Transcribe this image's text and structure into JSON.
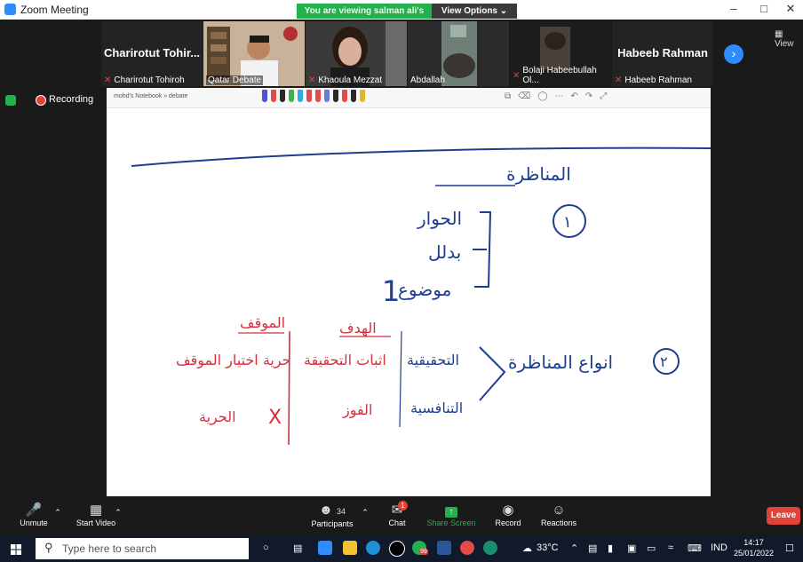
{
  "window": {
    "title": "Zoom Meeting"
  },
  "share_banner": {
    "text": "You are viewing salman ali's screen",
    "view_options": "View Options ⌄"
  },
  "window_controls": {
    "minimize": "–",
    "maximize": "□",
    "close": "✕"
  },
  "participants_strip": {
    "tiles": [
      {
        "big_name": "Charirotut Tohir...",
        "label": "Charirotut Tohiroh",
        "muted": true
      },
      {
        "label": "Qatar Debate",
        "muted": false
      },
      {
        "label": "Khaoula Mezzat",
        "muted": true
      },
      {
        "label": "Abdallah",
        "muted": false
      },
      {
        "label": "Bolaji Habeebullah Ol...",
        "muted": true
      },
      {
        "big_name": "Habeeb Rahman",
        "label": "Habeeb Rahman",
        "muted": true
      }
    ],
    "next_icon": "chevron-right-icon",
    "view_label": "View"
  },
  "recording": {
    "label": "Recording"
  },
  "notebook": {
    "breadcrumb": "mohd's Notebook » debate",
    "pen_colors": [
      "#4a53d6",
      "#e34a4a",
      "#2a2a2a",
      "#39b54a",
      "#2ab0e0",
      "#e34a4a",
      "#e34a4a",
      "#6b7bd6",
      "#2a2a2a",
      "#e34a4a",
      "#2a2a2a",
      "#e3b52a"
    ]
  },
  "whiteboard": {
    "heading": "المناظرة",
    "circle_1": "١",
    "items": [
      "الحوار",
      "بدلل",
      "موضوع"
    ],
    "item_num": "1",
    "circle_2": "٢",
    "types_title": "انواع المناظرة",
    "type_1": "التحقيقية",
    "type_2": "التنافسية",
    "goal_header": "الهدف",
    "goal_1": "اثبات التحقيقة",
    "goal_2": "الفوز",
    "stance_header": "الموقف",
    "stance_1": "حرية اختيار الموقف",
    "stance_2": "الحرية",
    "cross": "X"
  },
  "controls": {
    "unmute": "Unmute",
    "start_video": "Start Video",
    "participants": "Participants",
    "participants_count": "34",
    "chat": "Chat",
    "chat_badge": "1",
    "share_screen": "Share Screen",
    "record": "Record",
    "reactions": "Reactions",
    "leave": "Leave"
  },
  "taskbar": {
    "search_placeholder": "Type here to search",
    "weather": "33°C",
    "lang": "IND",
    "time": "14:17",
    "date": "25/01/2022",
    "badge": "99"
  }
}
